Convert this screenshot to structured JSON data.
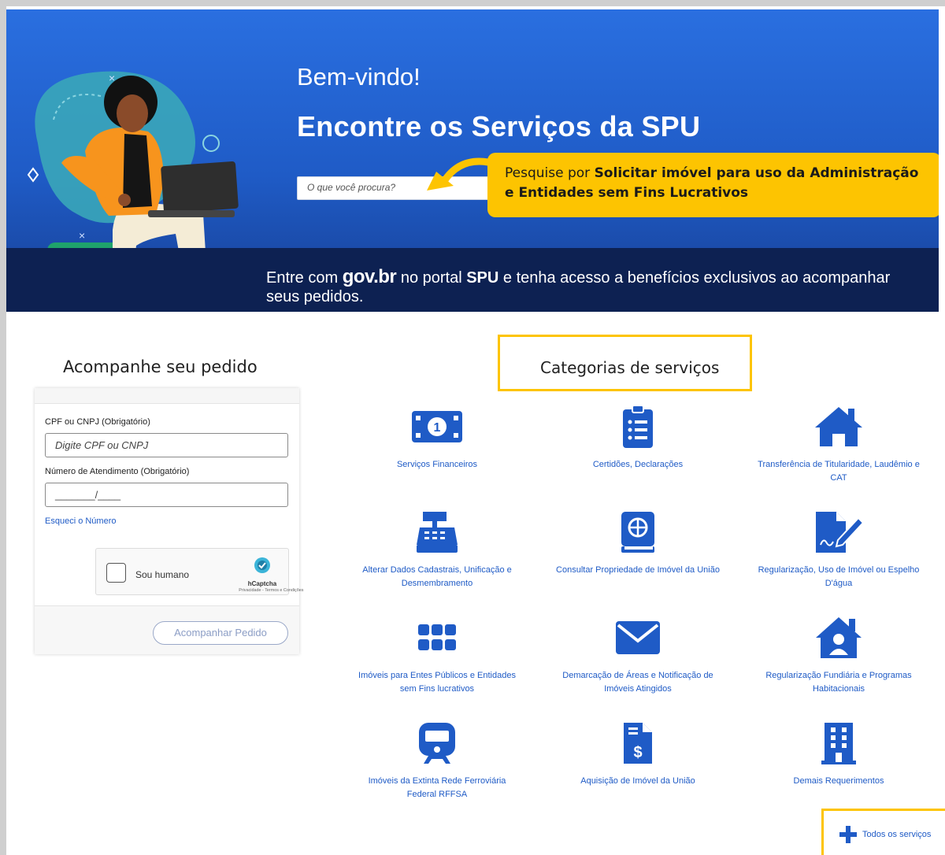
{
  "hero": {
    "welcome": "Bem-vindo!",
    "title": "Encontre os Serviços da SPU",
    "search_placeholder": "O que você procura?",
    "callout_prefix": "Pesquise por ",
    "callout_bold": "Solicitar imóvel para uso da Administração e Entidades sem Fins Lucrativos",
    "band_prefix": "Entre com ",
    "band_gov": "gov.br",
    "band_middle": " no portal ",
    "band_spu": "SPU",
    "band_suffix": " e tenha acesso a benefícios exclusivos ao acompanhar seus pedidos."
  },
  "tracking": {
    "title": "Acompanhe seu pedido",
    "cpf_label": "CPF ou CNPJ  (Obrigatório)",
    "cpf_placeholder": "Digite CPF ou CNPJ",
    "number_label": "Número de Atendimento  (Obrigatório)",
    "number_placeholder": "_______/____",
    "forgot_link": "Esqueci o Número",
    "captcha_label": "Sou humano",
    "captcha_brand": "hCaptcha",
    "captcha_links": "Privacidade - Termos e Condições",
    "submit_label": "Acompanhar Pedido"
  },
  "categories": {
    "title": "Categorias de serviços",
    "items": [
      {
        "label": "Serviços Financeiros",
        "icon": "money-icon"
      },
      {
        "label": "Certidões, Declarações",
        "icon": "clipboard-list-icon"
      },
      {
        "label": "Transferência de Titularidade, Laudêmio e CAT",
        "icon": "house-icon"
      },
      {
        "label": "Alterar Dados Cadastrais, Unificação e Desmembramento",
        "icon": "cash-register-icon"
      },
      {
        "label": "Consultar Propriedade de Imóvel da União",
        "icon": "atlas-icon"
      },
      {
        "label": "Regularização, Uso de Imóvel ou Espelho D'água",
        "icon": "file-signature-icon"
      },
      {
        "label": "Imóveis para Entes Públicos e Entidades sem Fins lucrativos",
        "icon": "grid-icon"
      },
      {
        "label": "Demarcação de Áreas e Notificação de Imóveis Atingidos",
        "icon": "envelope-icon"
      },
      {
        "label": "Regularização Fundiária e Programas Habitacionais",
        "icon": "house-user-icon"
      },
      {
        "label": "Imóveis da Extinta Rede Ferroviária Federal RFFSA",
        "icon": "train-icon"
      },
      {
        "label": "Aquisição de Imóvel da União",
        "icon": "file-invoice-dollar-icon"
      },
      {
        "label": "Demais Requerimentos",
        "icon": "building-icon"
      }
    ],
    "all_services": "Todos os serviços"
  },
  "colors": {
    "primary": "#1f5bc6",
    "highlight": "#fdc401",
    "band": "#0d2152"
  }
}
